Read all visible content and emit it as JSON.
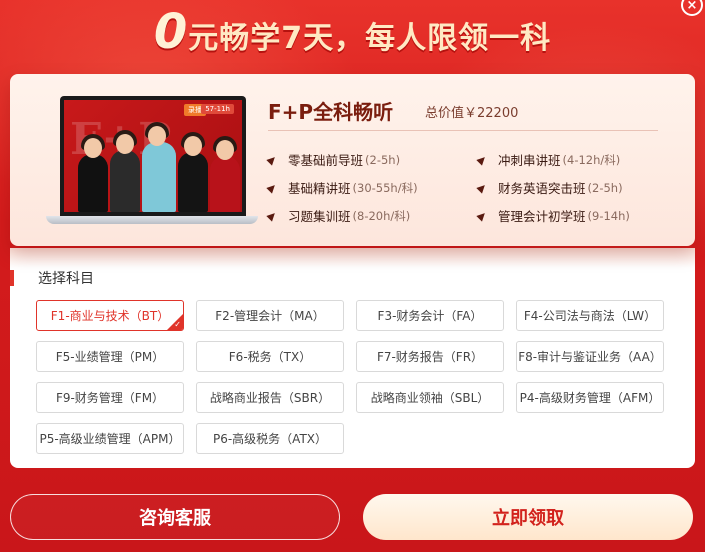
{
  "headline": {
    "zero": "0",
    "text": "元畅学7天，每人限领一科"
  },
  "close_icon": "×",
  "product": {
    "title": "F+P全科畅听",
    "price": "总价值￥22200",
    "screen_badge_left": "录播",
    "screen_badge_right": "57-11h",
    "courses": [
      {
        "name": "零基础前导班",
        "hours": "(2-5h)"
      },
      {
        "name": "冲刺串讲班",
        "hours": "(4-12h/科)"
      },
      {
        "name": "基础精讲班",
        "hours": "(30-55h/科)"
      },
      {
        "name": "财务英语突击班",
        "hours": "(2-5h)"
      },
      {
        "name": "习题集训班",
        "hours": "(8-20h/科)"
      },
      {
        "name": "管理会计初学班",
        "hours": "(9-14h)"
      }
    ]
  },
  "subjects": {
    "label": "选择科目",
    "items": [
      "F1-商业与技术（BT）",
      "F2-管理会计（MA）",
      "F3-财务会计（FA）",
      "F4-公司法与商法（LW）",
      "F5-业绩管理（PM）",
      "F6-税务（TX）",
      "F7-财务报告（FR）",
      "F8-审计与鉴证业务（AA）",
      "F9-财务管理（FM）",
      "战略商业报告（SBR）",
      "战略商业领袖（SBL）",
      "P4-高级财务管理（AFM）",
      "P5-高级业绩管理（APM）",
      "P6-高级税务（ATX）"
    ],
    "selected_index": 0
  },
  "buttons": {
    "consult": "咨询客服",
    "claim": "立即领取"
  },
  "colors": {
    "accent": "#e0342a",
    "background": "#d81e1e",
    "headline": "#ffe9c4"
  }
}
